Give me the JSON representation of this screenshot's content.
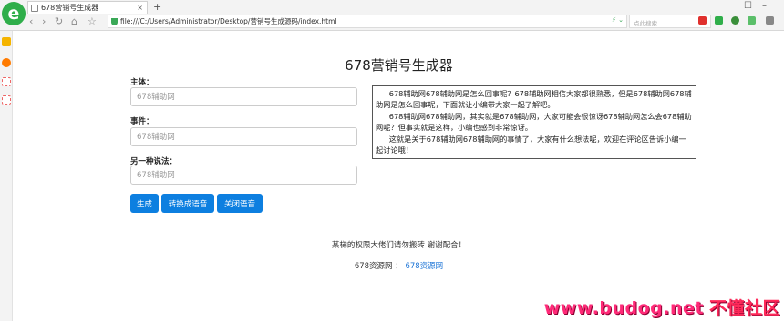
{
  "browser": {
    "tab_title": "678营销号生成器",
    "tab_close": "×",
    "new_tab": "+",
    "url": "file:///C:/Users/Administrator/Desktop/营销号生成源码/index.html",
    "search_placeholder": "点此搜索"
  },
  "page": {
    "title": "678营销号生成器",
    "subject_label": "主体：",
    "subject_placeholder": "678辅助网",
    "event_label": "事件：",
    "event_placeholder": "678辅助网",
    "alt_label": "另一种说法：",
    "alt_placeholder": "678辅助网",
    "buttons": {
      "generate": "生成",
      "to_speech": "转换成语音",
      "stop_speech": "关闭语音"
    },
    "output": [
      "678辅助网678辅助网是怎么回事呢？678辅助网相信大家都很熟悉，但是678辅助网678辅助网是怎么回事呢，下面就让小编带大家一起了解吧。",
      "678辅助网678辅助网，其实就是678辅助网，大家可能会很惊讶678辅助网怎么会678辅助网呢？但事实就是这样，小编也感到非常惊讶。",
      "这就是关于678辅助网678辅助网的事情了，大家有什么想法呢，欢迎在评论区告诉小编一起讨论哦！"
    ],
    "notice": "某梯的权限大佬们请勿搬砖 谢谢配合！",
    "source_label": "678资源网 ：",
    "source_link": "678资源网"
  },
  "watermark": {
    "url": "www.budog.net",
    "cn": "不懂社区"
  },
  "colors": {
    "primary_button": "#0d7fe0",
    "browser_logo": "#2fae4a",
    "watermark": "#ff2a78"
  }
}
